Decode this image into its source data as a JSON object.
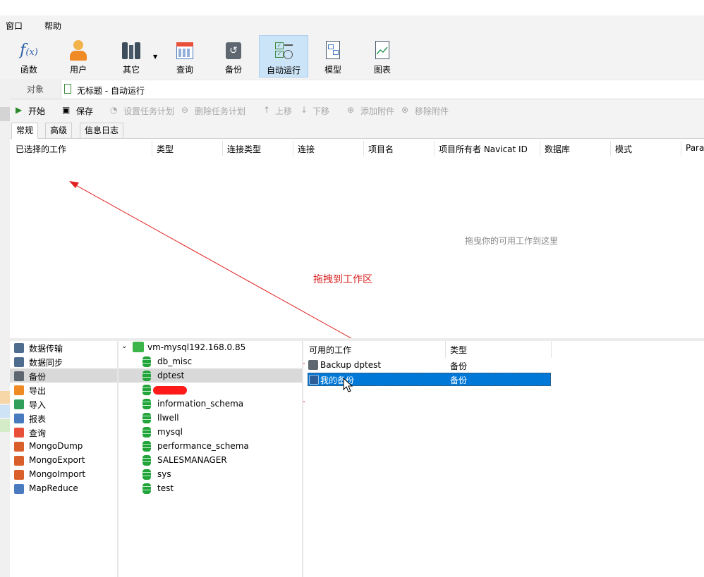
{
  "menu": {
    "items": [
      "窗口",
      "帮助"
    ]
  },
  "ribbon": {
    "buttons": [
      {
        "label": "函数",
        "icon": "function-icon"
      },
      {
        "label": "用户",
        "icon": "user-icon"
      },
      {
        "label": "其它",
        "icon": "tools-icon"
      },
      {
        "label": "查询",
        "icon": "query-icon"
      },
      {
        "label": "备份",
        "icon": "backup-icon"
      },
      {
        "label": "自动运行",
        "icon": "automation-icon",
        "active": true
      },
      {
        "label": "模型",
        "icon": "model-icon"
      },
      {
        "label": "图表",
        "icon": "chart-icon"
      }
    ]
  },
  "tabs": {
    "objects": "对象",
    "document": "无标题 - 自动运行"
  },
  "toolbar": {
    "start": "开始",
    "save": "保存",
    "set_schedule": "设置任务计划",
    "delete_schedule": "删除任务计划",
    "move_up": "上移",
    "move_down": "下移",
    "add_attachment": "添加附件",
    "remove_attachment": "移除附件"
  },
  "subtabs": [
    "常规",
    "高级",
    "信息日志"
  ],
  "grid": {
    "columns": [
      "已选择的工作",
      "类型",
      "连接类型",
      "连接",
      "项目名",
      "项目所有者 Navicat ID",
      "数据库",
      "模式",
      "Para"
    ],
    "empty_hint": "拖曳你的可用工作到这里"
  },
  "annotation": {
    "text": "拖拽到工作区",
    "color": "#d82020"
  },
  "categories": [
    {
      "label": "数据传输",
      "icon": "data-transfer-icon"
    },
    {
      "label": "数据同步",
      "icon": "data-sync-icon"
    },
    {
      "label": "备份",
      "icon": "backup-icon",
      "selected": true
    },
    {
      "label": "导出",
      "icon": "export-icon"
    },
    {
      "label": "导入",
      "icon": "import-icon"
    },
    {
      "label": "报表",
      "icon": "report-icon"
    },
    {
      "label": "查询",
      "icon": "query-icon"
    },
    {
      "label": "MongoDump",
      "icon": "mongodump-icon"
    },
    {
      "label": "MongoExport",
      "icon": "mongoexport-icon"
    },
    {
      "label": "MongoImport",
      "icon": "mongoimport-icon"
    },
    {
      "label": "MapReduce",
      "icon": "mapreduce-icon"
    }
  ],
  "tree": {
    "connection": "vm-mysql192.168.0.85",
    "databases": [
      "db_misc",
      "dptest",
      "",
      "information_schema",
      "llwell",
      "mysql",
      "performance_schema",
      "SALESMANAGER",
      "sys",
      "test"
    ],
    "selected_index": 1
  },
  "available": {
    "headers": [
      "可用的工作",
      "类型"
    ],
    "rows": [
      {
        "name": "Backup dptest",
        "type": "备份"
      },
      {
        "name": "我的备份",
        "type": "备份",
        "selected": true
      }
    ]
  },
  "colors": {
    "accent": "#0078d7",
    "db_green": "#22a43a",
    "redact": "#ff1a1a"
  }
}
